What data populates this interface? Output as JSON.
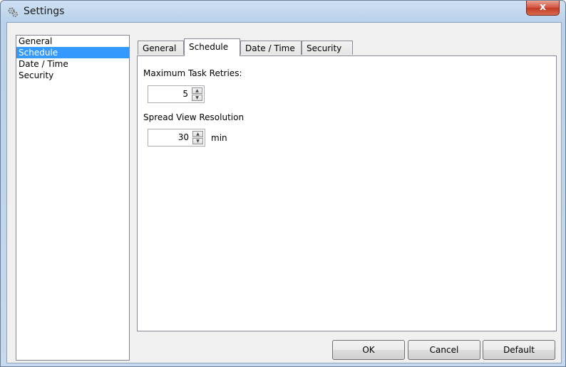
{
  "window": {
    "title": "Settings",
    "close_label": "x"
  },
  "sidebar": {
    "items": [
      {
        "label": "General"
      },
      {
        "label": "Schedule"
      },
      {
        "label": "Date / Time"
      },
      {
        "label": "Security"
      }
    ],
    "selected": "Schedule"
  },
  "tabs": [
    {
      "label": "General"
    },
    {
      "label": "Schedule"
    },
    {
      "label": "Date / Time"
    },
    {
      "label": "Security"
    }
  ],
  "active_tab": "Schedule",
  "schedule": {
    "max_retries_label": "Maximum Task Retries:",
    "max_retries_value": "5",
    "spread_label": "Spread View Resolution",
    "spread_value": "30",
    "spread_unit": "min"
  },
  "buttons": {
    "ok": "OK",
    "cancel": "Cancel",
    "default": "Default"
  },
  "icons": {
    "app": "gears-icon",
    "spin_up": "arrow-up-icon",
    "spin_down": "arrow-down-icon"
  }
}
